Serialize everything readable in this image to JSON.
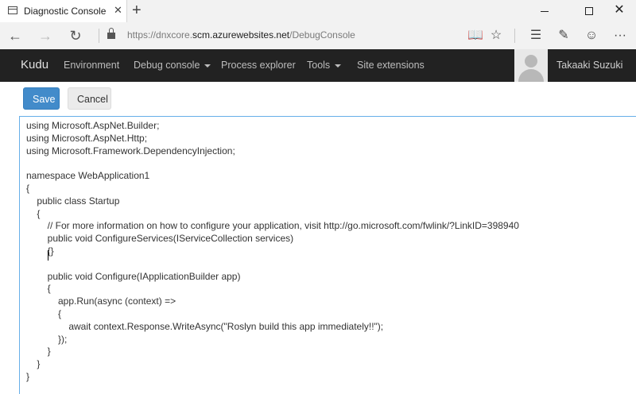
{
  "browser": {
    "tab_title": "Diagnostic Console",
    "tab_close": "✕",
    "new_tab": "+",
    "url_prefix": "https://dnxcore.",
    "url_host": "scm.azurewebsites.net",
    "url_path": "/DebugConsole",
    "window": {
      "minimize": "minimize",
      "maximize": "maximize",
      "close": "✕"
    },
    "icons": [
      "back-arrow-icon",
      "forward-arrow-icon",
      "refresh-icon",
      "lock-icon",
      "reading-view-icon",
      "favorite-star-icon",
      "hub-icon",
      "web-note-icon",
      "feedback-smiley-icon",
      "more-icon"
    ]
  },
  "kudu": {
    "brand": "Kudu",
    "nav": [
      {
        "label": "Environment",
        "dropdown": false
      },
      {
        "label": "Debug console",
        "dropdown": true
      },
      {
        "label": "Process explorer",
        "dropdown": false
      },
      {
        "label": "Tools",
        "dropdown": true
      },
      {
        "label": "Site extensions",
        "dropdown": false
      }
    ],
    "user": "Takaaki Suzuki"
  },
  "editor": {
    "save_label": "Save",
    "cancel_label": "Cancel",
    "lines": [
      "using Microsoft.AspNet.Builder;",
      "using Microsoft.AspNet.Http;",
      "using Microsoft.Framework.DependencyInjection;",
      "",
      "namespace WebApplication1",
      "{",
      "    public class Startup",
      "    {",
      "        // For more information on how to configure your application, visit http://go.microsoft.com/fwlink/?LinkID=398940",
      "        public void ConfigureServices(IServiceCollection services)",
      "        {}",
      "",
      "        public void Configure(IApplicationBuilder app)",
      "        {",
      "            app.Run(async (context) =>",
      "            {",
      "                await context.Response.WriteAsync(\"Roslyn build this app immediately!!\");",
      "            });",
      "        }",
      "    }",
      "}"
    ]
  },
  "colors": {
    "kudu_bar": "#222222",
    "save_button": "#428bca",
    "editor_focus_border": "#66afe9"
  }
}
